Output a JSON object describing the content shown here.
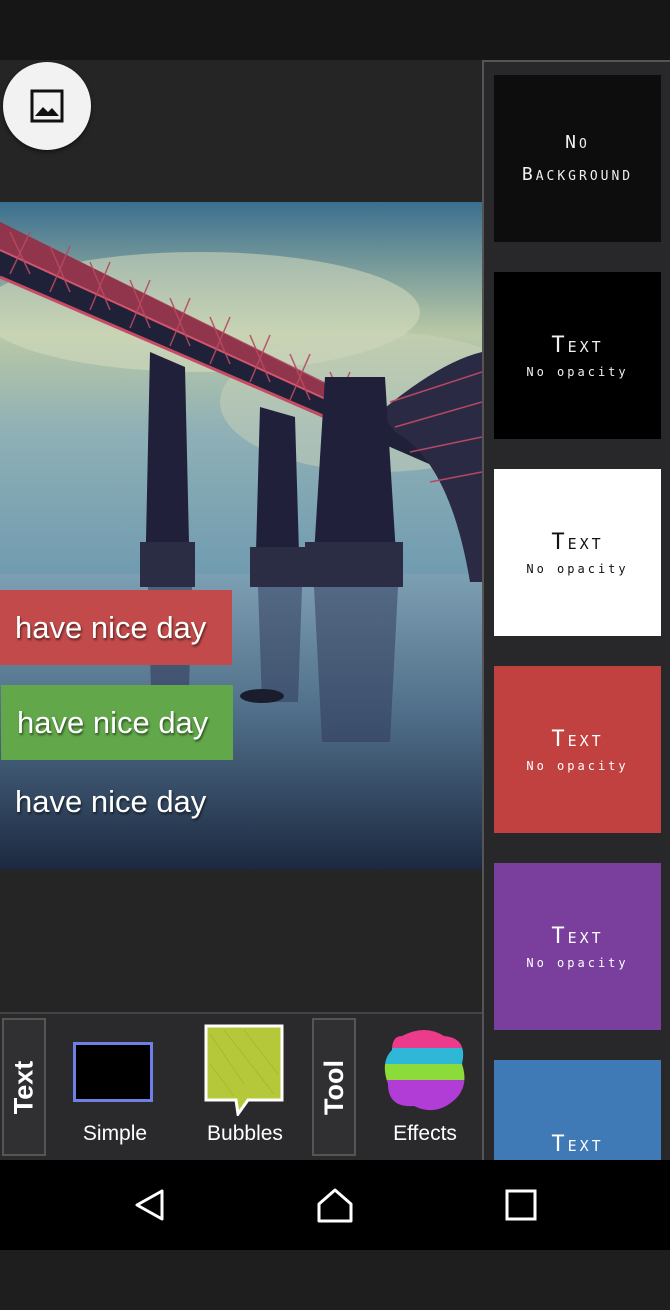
{
  "canvas": {
    "texts": [
      {
        "label": "have nice day",
        "background": "#c24a4a"
      },
      {
        "label": "have nice day",
        "background": "#62a84a"
      },
      {
        "label": "have nice day",
        "background": "transparent"
      }
    ]
  },
  "styles_panel": {
    "items": [
      {
        "line1": "No",
        "line2": "Background",
        "bg": "#0d0d0e"
      },
      {
        "line1": "Text",
        "line2": "No opacity",
        "bg": "#000000"
      },
      {
        "line1": "Text",
        "line2": "No opacity",
        "bg": "#ffffff"
      },
      {
        "line1": "Text",
        "line2": "No opacity",
        "bg": "#c0413f"
      },
      {
        "line1": "Text",
        "line2": "No opacity",
        "bg": "#7a3e9d"
      },
      {
        "line1": "Text",
        "bg": "#3f79b6"
      }
    ]
  },
  "toolbar": {
    "text_tab": "Text",
    "simple_label": "Simple",
    "bubbles_label": "Bubbles",
    "tool_tab": "Tool",
    "effects_label": "Effects"
  },
  "icons": {
    "gallery": "image-icon",
    "nav_back": "back-triangle-icon",
    "nav_home": "home-icon",
    "nav_recent": "recent-apps-icon"
  },
  "colors": {
    "simple_border": "#6e80e6",
    "bubble_fill": "#b5c83a"
  }
}
